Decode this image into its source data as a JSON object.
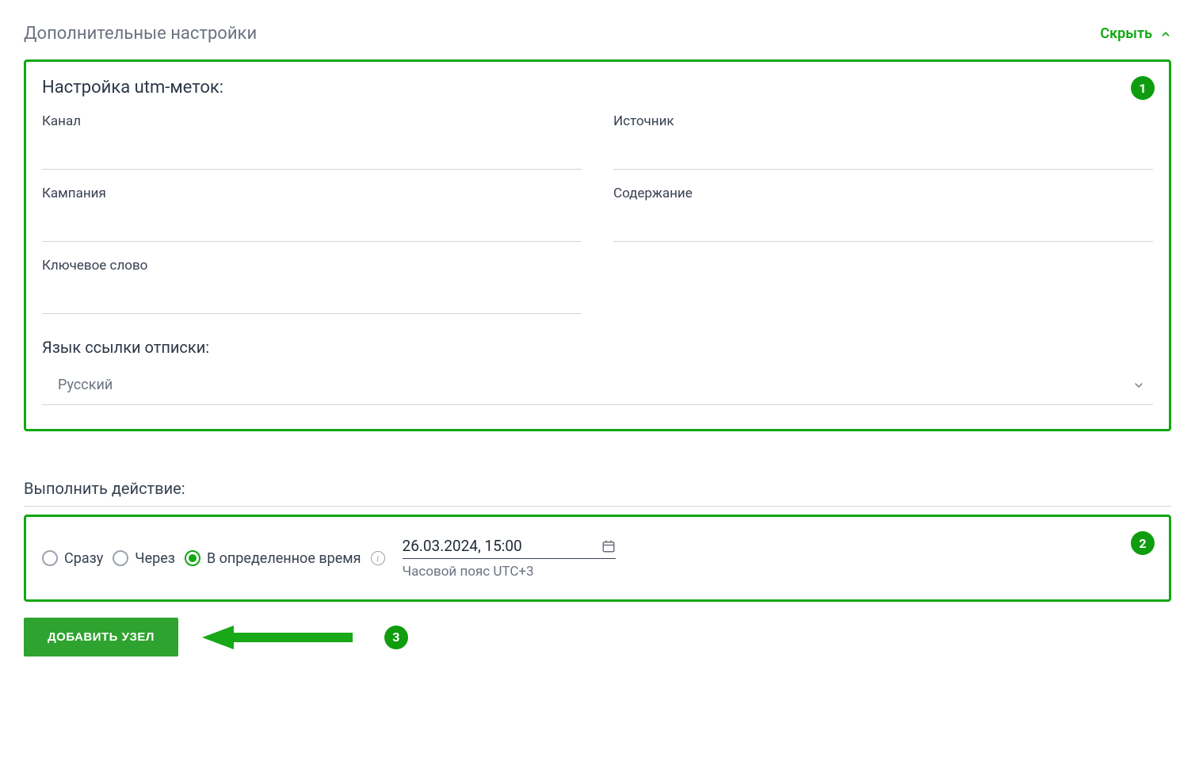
{
  "header": {
    "title": "Дополнительные настройки",
    "hide_label": "Скрыть"
  },
  "utm": {
    "section_title": "Настройка utm-меток:",
    "badge": "1",
    "fields": {
      "channel": {
        "label": "Канал",
        "value": ""
      },
      "source": {
        "label": "Источник",
        "value": ""
      },
      "campaign": {
        "label": "Кампания",
        "value": ""
      },
      "content": {
        "label": "Содержание",
        "value": ""
      },
      "keyword": {
        "label": "Ключевое слово",
        "value": ""
      }
    }
  },
  "language": {
    "title": "Язык ссылки отписки:",
    "selected": "Русский"
  },
  "action": {
    "title": "Выполнить действие:",
    "badge": "2",
    "radios": {
      "immediately": "Сразу",
      "after": "Через",
      "at_time": "В определенное время"
    },
    "datetime_value": "26.03.2024, 15:00",
    "timezone": "Часовой пояс UTC+3"
  },
  "footer": {
    "add_button": "ДОБАВИТЬ УЗЕЛ",
    "badge": "3"
  }
}
